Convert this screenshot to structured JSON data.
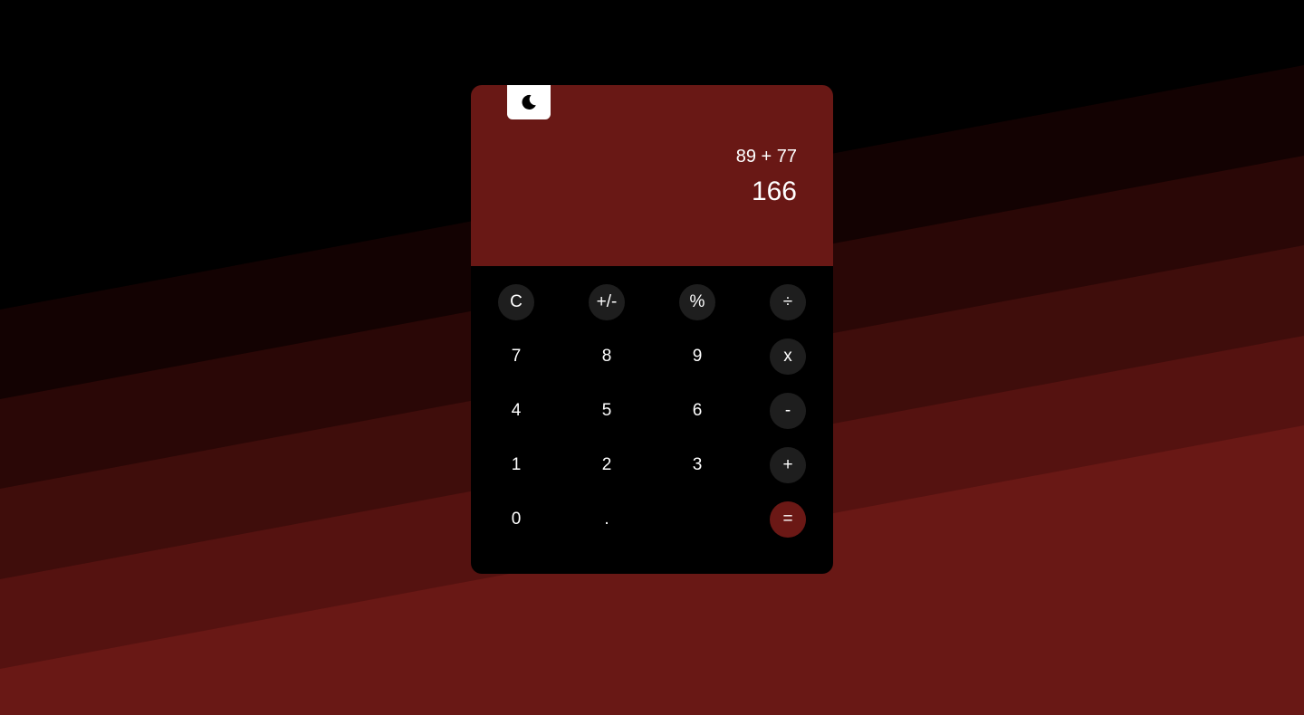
{
  "colors": {
    "screen_bg": "#691815",
    "keypad_bg": "#000000",
    "function_key_bg": "#1e1e1e",
    "equals_key_bg": "#6b1815",
    "toggle_bg": "#ffffff"
  },
  "theme_toggle": {
    "icon": "moon-icon"
  },
  "display": {
    "expression": "89 + 77",
    "result": "166"
  },
  "keys": {
    "clear": "C",
    "sign": "+/-",
    "percent": "%",
    "divide": "÷",
    "seven": "7",
    "eight": "8",
    "nine": "9",
    "multiply": "x",
    "four": "4",
    "five": "5",
    "six": "6",
    "subtract": "-",
    "one": "1",
    "two": "2",
    "three": "3",
    "add": "+",
    "zero": "0",
    "decimal": ".",
    "equals": "="
  }
}
